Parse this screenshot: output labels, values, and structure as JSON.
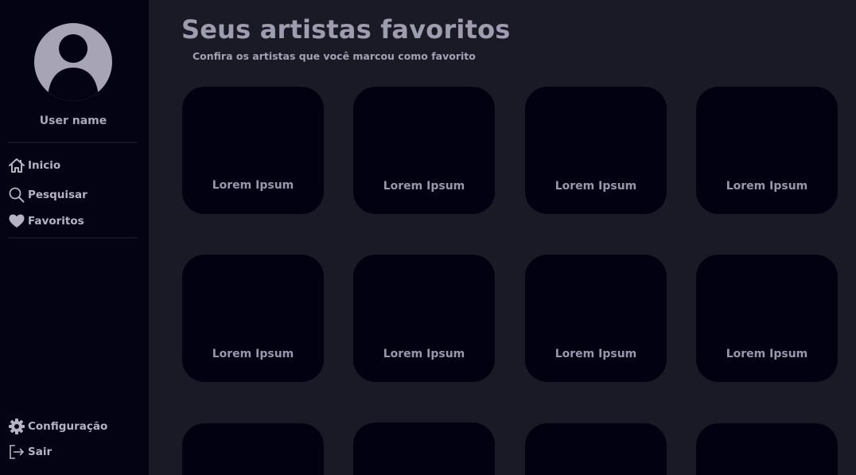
{
  "sidebar": {
    "username": "User name",
    "nav": [
      {
        "label": "Inicio",
        "icon": "home-icon"
      },
      {
        "label": "Pesquisar",
        "icon": "search-icon"
      },
      {
        "label": "Favoritos",
        "icon": "heart-icon"
      }
    ],
    "bottom": [
      {
        "label": "Configuração",
        "icon": "gear-icon"
      },
      {
        "label": "Sair",
        "icon": "logout-icon"
      }
    ]
  },
  "main": {
    "title": "Seus artistas favoritos",
    "subtitle": "Confira os artistas que você marcou como favorito",
    "artists": [
      {
        "name": "Lorem Ipsum"
      },
      {
        "name": "Lorem Ipsum"
      },
      {
        "name": "Lorem Ipsum"
      },
      {
        "name": "Lorem Ipsum"
      },
      {
        "name": "Lorem Ipsum"
      },
      {
        "name": "Lorem Ipsum"
      },
      {
        "name": "Lorem Ipsum"
      },
      {
        "name": "Lorem Ipsum"
      },
      {
        "name": ""
      },
      {
        "name": ""
      },
      {
        "name": ""
      },
      {
        "name": ""
      }
    ]
  },
  "colors": {
    "sidebar_bg": "#040313",
    "main_bg": "#1a1926",
    "card_bg": "#020112",
    "text": "#a4a1b3"
  }
}
